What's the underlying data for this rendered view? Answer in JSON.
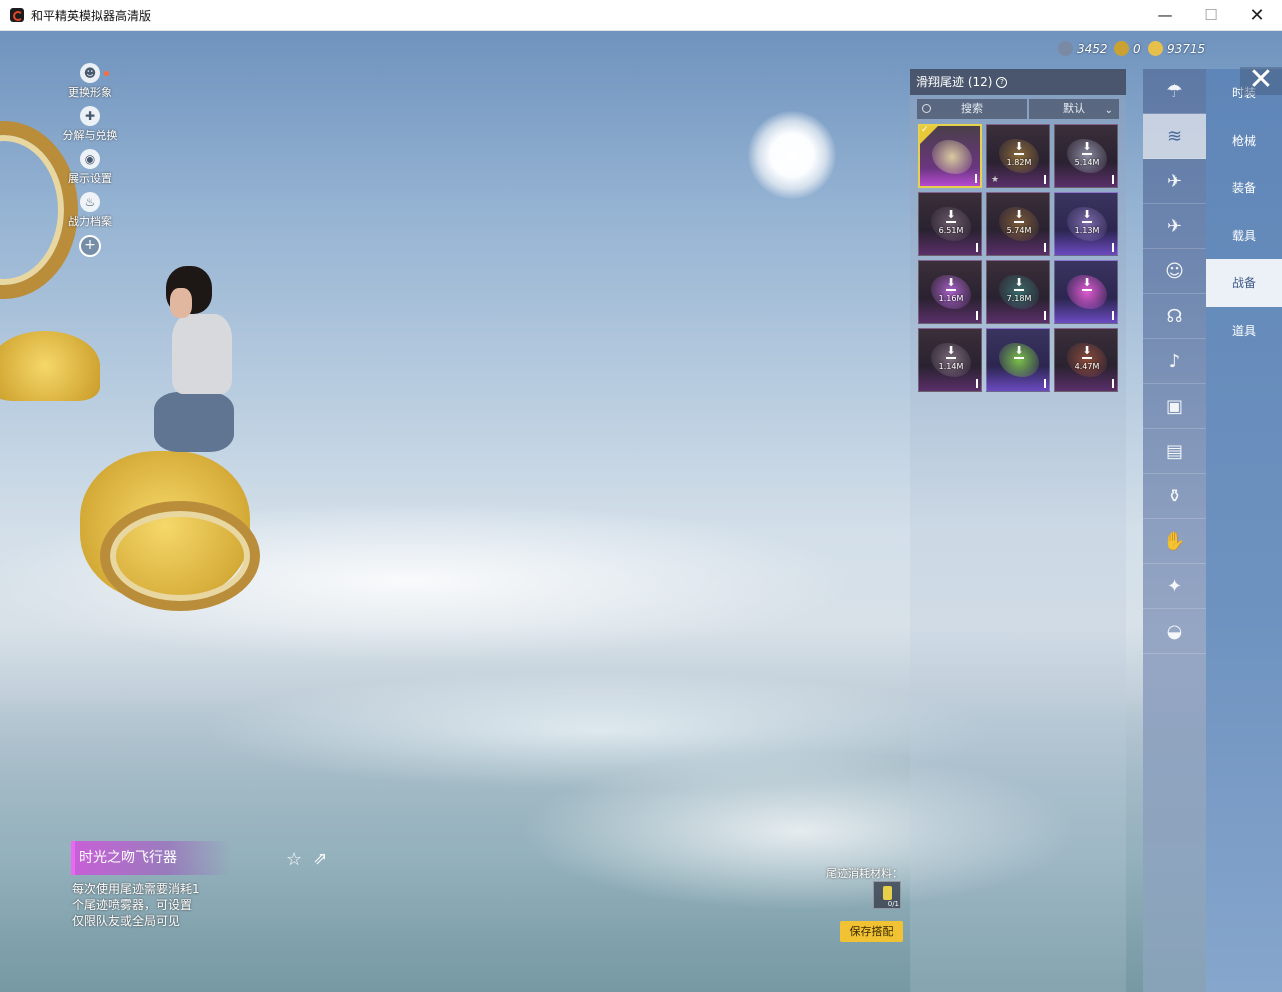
{
  "window": {
    "title": "和平精英模拟器高清版",
    "controls": {
      "minimize": "—",
      "maximize": "☐",
      "close": "✕"
    }
  },
  "left_menu": [
    {
      "label": "更换形象",
      "icon": "avatar-icon",
      "glyph": "☻"
    },
    {
      "label": "分解与兑换",
      "icon": "puzzle-icon",
      "glyph": "✚"
    },
    {
      "label": "展示设置",
      "icon": "eye-icon",
      "glyph": "◉"
    },
    {
      "label": "战力档案",
      "icon": "flame-icon",
      "glyph": "♨"
    }
  ],
  "left_menu_add": "+",
  "currency": [
    {
      "icon": "coin-silver-icon",
      "value": "3452",
      "color": "#7b8aa4"
    },
    {
      "icon": "coin-gold-ring-icon",
      "value": "0",
      "color": "#c9a233"
    },
    {
      "icon": "coin-gold-icon",
      "value": "93715",
      "color": "#e6c04b"
    }
  ],
  "panel": {
    "title": "滑翔尾迹 (12)",
    "info": "?",
    "search_label": "搜索",
    "sort_label": "默认",
    "sort_chevron": "⌄",
    "tiles": [
      {
        "size": "",
        "selected": true,
        "star": false,
        "art": "#d9c9a0"
      },
      {
        "size": "1.82M",
        "selected": false,
        "star": true,
        "art": "#8a6a3a"
      },
      {
        "size": "5.14M",
        "selected": false,
        "star": false,
        "art": "#8a8aa0"
      },
      {
        "size": "6.51M",
        "selected": false,
        "star": false,
        "art": "#6a5a6a"
      },
      {
        "size": "5.74M",
        "selected": false,
        "star": false,
        "art": "#7a5a3a"
      },
      {
        "size": "1.13M",
        "selected": false,
        "star": false,
        "art": "#7a6aa8"
      },
      {
        "size": "1.16M",
        "selected": false,
        "star": false,
        "art": "#a860c8"
      },
      {
        "size": "7.18M",
        "selected": false,
        "star": false,
        "art": "#3a6a6a"
      },
      {
        "size": "",
        "selected": false,
        "star": false,
        "art": "#e05ad0"
      },
      {
        "size": "1.14M",
        "selected": false,
        "star": false,
        "art": "#7a6a7a"
      },
      {
        "size": "",
        "selected": false,
        "star": false,
        "art": "#7ac04a"
      },
      {
        "size": "4.47M",
        "selected": false,
        "star": false,
        "art": "#8a4a3a"
      }
    ],
    "download_glyph": "⬇",
    "star_glyph": "★"
  },
  "icon_strip": [
    {
      "icon": "parachute-icon",
      "glyph": "☂"
    },
    {
      "icon": "glider-trail-icon",
      "glyph": "≋"
    },
    {
      "icon": "drone-icon",
      "glyph": "✈"
    },
    {
      "icon": "plane-icon",
      "glyph": "✈"
    },
    {
      "icon": "emote-icon",
      "glyph": "☺"
    },
    {
      "icon": "companion-icon",
      "glyph": "☊"
    },
    {
      "icon": "voice-icon",
      "glyph": "♪"
    },
    {
      "icon": "badge-icon",
      "glyph": "▣"
    },
    {
      "icon": "gallery-icon",
      "glyph": "▤"
    },
    {
      "icon": "spray-icon",
      "glyph": "⚱"
    },
    {
      "icon": "hand-icon",
      "glyph": "✋"
    },
    {
      "icon": "sparkle-icon",
      "glyph": "✦"
    },
    {
      "icon": "planet-icon",
      "glyph": "◒"
    }
  ],
  "categories": [
    {
      "label": "时装",
      "active": false
    },
    {
      "label": "枪械",
      "active": false
    },
    {
      "label": "装备",
      "active": false
    },
    {
      "label": "载具",
      "active": false
    },
    {
      "label": "战备",
      "active": true
    },
    {
      "label": "道具",
      "active": false
    }
  ],
  "close_glyph": "✕",
  "item": {
    "name": "时光之吻飞行器",
    "fav_glyph": "☆",
    "share_glyph": "⇗",
    "description": [
      "每次使用尾迹需要消耗1",
      "个尾迹喷雾器，可设置",
      "仅限队友或全局可见"
    ]
  },
  "material": {
    "label": "尾迹消耗材料：",
    "count": "0/1",
    "save_label": "保存搭配"
  }
}
